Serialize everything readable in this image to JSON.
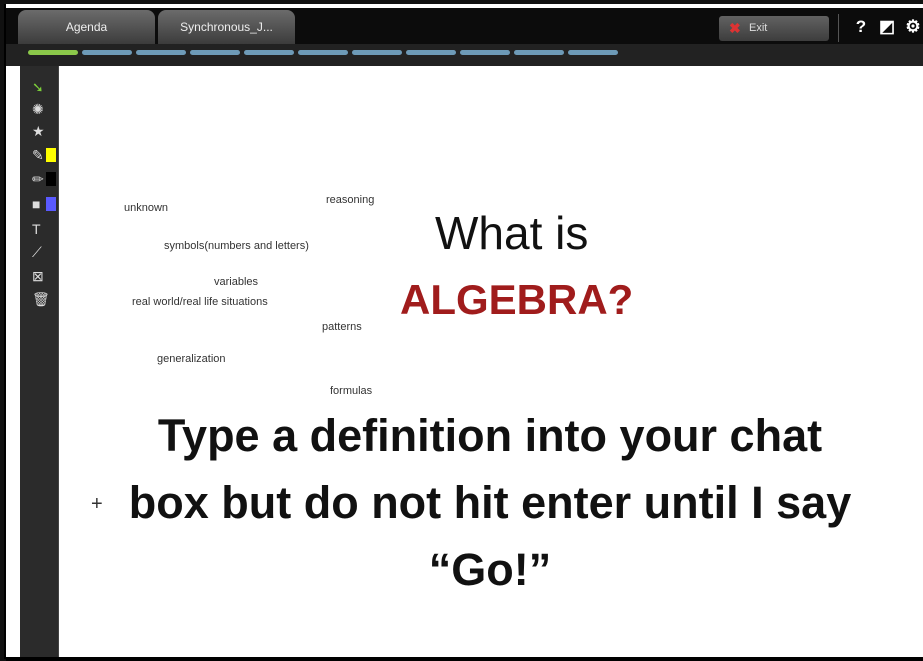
{
  "tabs": [
    {
      "label": "Agenda"
    },
    {
      "label": "Synchronous_J..."
    }
  ],
  "toolbar": {
    "exit_label": "Exit",
    "icons": [
      "help-icon",
      "settings-panel-icon",
      "gear-icon"
    ]
  },
  "progress": {
    "segments_total": 11,
    "active_index": 0,
    "colors": {
      "active": "#8bc84a",
      "inactive": "#6d9ab7"
    }
  },
  "tools": [
    {
      "name": "pointer-tool-icon",
      "glyph": "➘"
    },
    {
      "name": "laser-pointer-icon",
      "glyph": "✺"
    },
    {
      "name": "stamp-star-icon",
      "glyph": "★"
    },
    {
      "name": "highlighter-tool-icon",
      "glyph": "✎",
      "swatch": "#ffff00"
    },
    {
      "name": "pencil-tool-icon",
      "glyph": "✏",
      "swatch": "#000000"
    },
    {
      "name": "shape-tool-icon",
      "glyph": "■",
      "swatch": "#5a5aff"
    },
    {
      "name": "text-tool-icon",
      "glyph": "T"
    },
    {
      "name": "line-tool-icon",
      "glyph": "⟋"
    },
    {
      "name": "clear-tool-icon",
      "glyph": "⊠"
    },
    {
      "name": "trash-icon",
      "glyph": "🗑"
    }
  ],
  "slide": {
    "words": [
      "unknown",
      "reasoning",
      "symbols(numbers and letters)",
      "variables",
      "real world/real life situations",
      "patterns",
      "generalization",
      "formulas"
    ],
    "question_line1": "What is",
    "question_line2": "ALGEBRA?",
    "instruction_line1": "Type a definition into your chat",
    "instruction_line2": "box but do not hit enter until I say",
    "instruction_line3": "“Go!”",
    "cursor_glyph": "+",
    "accent_color": "#a01c1c"
  }
}
